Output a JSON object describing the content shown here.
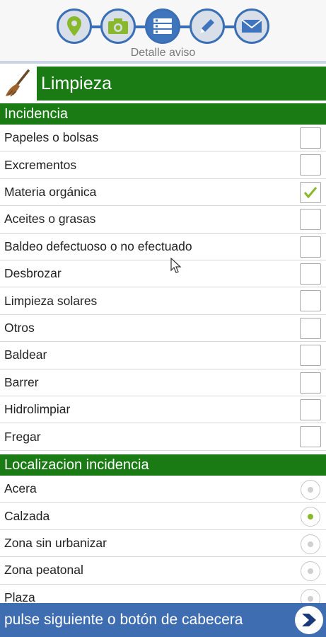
{
  "steps": {
    "items": [
      {
        "icon": "location-pin-icon"
      },
      {
        "icon": "camera-icon"
      },
      {
        "icon": "list-icon"
      },
      {
        "icon": "pencil-icon"
      },
      {
        "icon": "envelope-icon"
      }
    ],
    "active_index": 2,
    "caption": "Detalle aviso"
  },
  "category": {
    "icon": "broom-icon",
    "title": "Limpieza"
  },
  "incidencia": {
    "heading": "Incidencia",
    "items": [
      {
        "label": "Papeles o bolsas",
        "checked": false
      },
      {
        "label": "Excrementos",
        "checked": false
      },
      {
        "label": "Materia orgánica",
        "checked": true
      },
      {
        "label": "Aceites o grasas",
        "checked": false
      },
      {
        "label": "Baldeo defectuoso o no efectuado",
        "checked": false
      },
      {
        "label": "Desbrozar",
        "checked": false
      },
      {
        "label": "Limpieza solares",
        "checked": false
      },
      {
        "label": "Otros",
        "checked": false
      },
      {
        "label": "Baldear",
        "checked": false
      },
      {
        "label": "Barrer",
        "checked": false
      },
      {
        "label": "Hidrolimpiar",
        "checked": false
      },
      {
        "label": "Fregar",
        "checked": false
      }
    ]
  },
  "localizacion": {
    "heading": "Localizacion incidencia",
    "items": [
      {
        "label": "Acera",
        "selected": false
      },
      {
        "label": "Calzada",
        "selected": true
      },
      {
        "label": "Zona sin urbanizar",
        "selected": false
      },
      {
        "label": "Zona peatonal",
        "selected": false
      },
      {
        "label": "Plaza",
        "selected": false
      }
    ]
  },
  "footer": {
    "hint": "pulse siguiente o botón de cabecera",
    "next_icon": "chevron-right-icon"
  },
  "colors": {
    "green": "#1a7b14",
    "blue": "#3f6db1",
    "check": "#8ab82c",
    "step_icon": "#8ab82c"
  }
}
